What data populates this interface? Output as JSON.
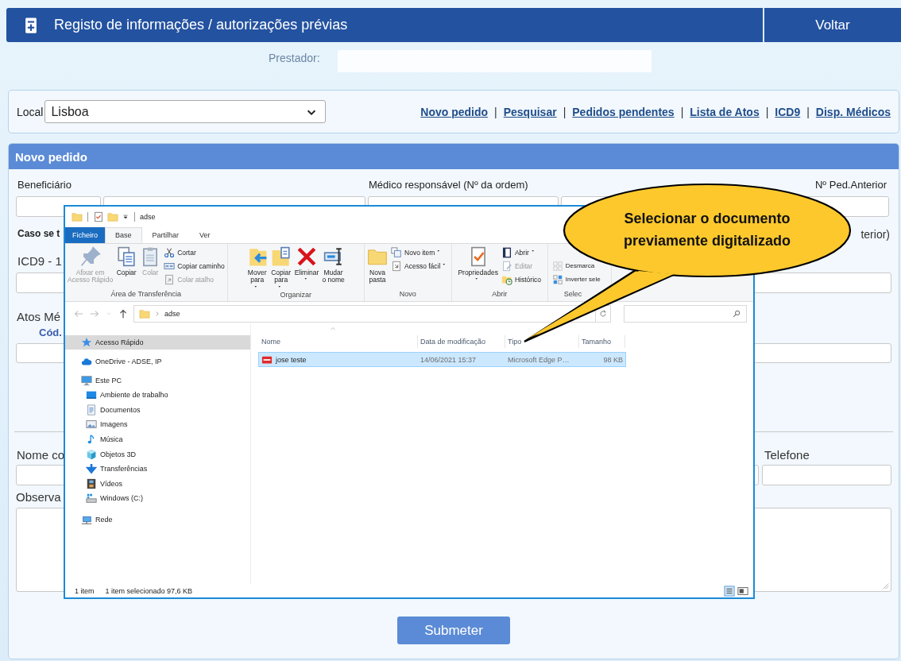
{
  "header": {
    "title": "Registo de informações / autorizações prévias",
    "back_button": "Voltar"
  },
  "provider": {
    "label": "Prestador:"
  },
  "location": {
    "label": "Local",
    "value": "Lisboa"
  },
  "nav_links": [
    "Novo pedido",
    "Pesquisar",
    "Pedidos pendentes",
    "Lista de Atos",
    "ICD9",
    "Disp. Médicos"
  ],
  "link_separator": "|",
  "form": {
    "title": "Novo pedido",
    "beneficiary_label": "Beneficiário",
    "doctor_label": "Médico responsável (Nº da ordem)",
    "previous_request_label": "Nº Ped.Anterior",
    "case_note_start": "Caso se t",
    "case_note_end": "terior)",
    "icd9_label": "ICD9 - 1",
    "acts_label": "Atos Mé",
    "code_column": "Cód.",
    "name_label": "Nome co",
    "phone_label": "Telefone",
    "notes_label": "Observa",
    "submit_button": "Submeter"
  },
  "explorer": {
    "title": "adse",
    "ribbon_tabs": [
      {
        "label": "Ficheiro",
        "kind": "menu",
        "selected": false
      },
      {
        "label": "Base",
        "kind": "tab",
        "selected": true
      },
      {
        "label": "Partilhar",
        "kind": "tab",
        "selected": false
      },
      {
        "label": "Ver",
        "kind": "tab",
        "selected": false
      }
    ],
    "ribbon_groups": [
      {
        "name": "Área de Transferência",
        "items": [
          {
            "label": "Afixar em\nAcesso Rápido",
            "kind": "large",
            "disabled": true,
            "has_menu": false
          },
          {
            "label": "Copiar",
            "kind": "large",
            "disabled": false,
            "has_menu": false
          },
          {
            "label": "Colar",
            "kind": "large",
            "disabled": true,
            "has_menu": false
          },
          {
            "label": "Cortar",
            "kind": "small",
            "disabled": false,
            "has_menu": false
          },
          {
            "label": "Copiar caminho",
            "kind": "small",
            "disabled": false,
            "has_menu": false
          },
          {
            "label": "Colar atalho",
            "kind": "small",
            "disabled": true,
            "has_menu": false
          }
        ]
      },
      {
        "name": "Organizar",
        "items": [
          {
            "label": "Mover\npara",
            "kind": "large",
            "disabled": false,
            "has_menu": true
          },
          {
            "label": "Copiar\npara",
            "kind": "large",
            "disabled": false,
            "has_menu": true
          },
          {
            "label": "Eliminar",
            "kind": "large",
            "disabled": false,
            "has_menu": true
          },
          {
            "label": "Mudar\no nome",
            "kind": "large",
            "disabled": false,
            "has_menu": false
          }
        ]
      },
      {
        "name": "Novo",
        "items": [
          {
            "label": "Nova\npasta",
            "kind": "large",
            "disabled": false,
            "has_menu": false
          },
          {
            "label": "Novo item",
            "kind": "small",
            "disabled": false,
            "has_menu": true
          },
          {
            "label": "Acesso fácil",
            "kind": "small",
            "disabled": false,
            "has_menu": true
          }
        ]
      },
      {
        "name": "Abrir",
        "items": [
          {
            "label": "Propriedades",
            "kind": "large",
            "disabled": false,
            "has_menu": true
          },
          {
            "label": "Abrir",
            "kind": "small",
            "disabled": false,
            "has_menu": true
          },
          {
            "label": "Editar",
            "kind": "small",
            "disabled": true,
            "has_menu": false
          },
          {
            "label": "Histórico",
            "kind": "small",
            "disabled": false,
            "has_menu": false
          }
        ]
      },
      {
        "name": "Selec",
        "items": [
          {
            "label": "Desmarca",
            "kind": "small",
            "disabled": false,
            "has_menu": false
          },
          {
            "label": "Inverter sele",
            "kind": "small",
            "disabled": false,
            "has_menu": false
          }
        ]
      }
    ],
    "address": {
      "path": "adse"
    },
    "nav_pane": [
      {
        "label": "Acesso Rápido",
        "selected": true
      },
      {
        "label": "OneDrive - ADSE, IP",
        "selected": false
      },
      {
        "label": "Este PC",
        "selected": false,
        "children": [
          {
            "label": "Ambiente de trabalho",
            "selected": false
          },
          {
            "label": "Documentos",
            "selected": false
          },
          {
            "label": "Imagens",
            "selected": false
          },
          {
            "label": "Música",
            "selected": false
          },
          {
            "label": "Objetos 3D",
            "selected": false
          },
          {
            "label": "Transferências",
            "selected": false
          },
          {
            "label": "Vídeos",
            "selected": false
          },
          {
            "label": "Windows (C:)",
            "selected": false
          }
        ]
      },
      {
        "label": "Rede",
        "selected": false
      }
    ],
    "columns": [
      "Nome",
      "Data de modificação",
      "Tipo",
      "Tamanho"
    ],
    "files": [
      {
        "cells": [
          "jose teste",
          "14/06/2021 15:37",
          "Microsoft Edge P…",
          "98 KB"
        ],
        "selected": true
      }
    ],
    "status": [
      "1 item",
      "1 item selecionado 97,6 KB"
    ]
  },
  "callout": {
    "text": "Selecionar o documento previamente digitalizado"
  }
}
